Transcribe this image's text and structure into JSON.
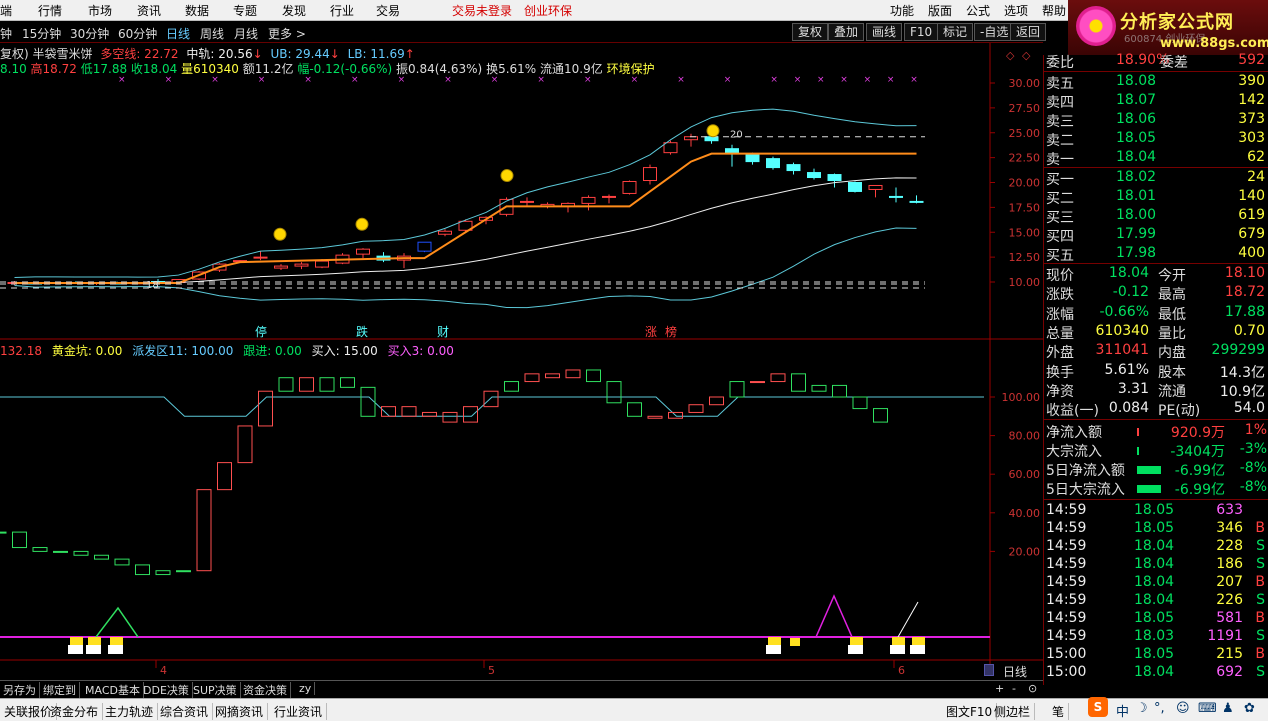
{
  "menu": {
    "items": [
      "端",
      "行情",
      "市场",
      "资讯",
      "数据",
      "专题",
      "发现",
      "行业",
      "交易"
    ],
    "login": "交易未登录",
    "promo": "创业环保",
    "right": [
      "功能",
      "版面",
      "公式",
      "选项",
      "帮助"
    ]
  },
  "periods": [
    "钟",
    "15分钟",
    "30分钟",
    "60分钟",
    "日线",
    "周线",
    "月线",
    "更多 >"
  ],
  "active_period": "日线",
  "toolbar": [
    "复权",
    "叠加",
    "画线",
    "F10",
    "标记",
    "-自选",
    "返回"
  ],
  "logo": {
    "title": "分析家公式网",
    "url": "www.88gs.com",
    "faint": "600874 创业环保"
  },
  "indicator_line": {
    "prefix": "复权) 半袋雪米饼",
    "duokong_label": "多空线: 22.72",
    "mid_label": "中轨: 20.56",
    "ub_label": "UB: 29.44",
    "lb_label": "LB: 11.69"
  },
  "ohlc_line": {
    "open": "8.10",
    "high": "高18.72",
    "low": "低17.88",
    "close": "收18.04",
    "volume": "量610340",
    "amount": "额11.2亿",
    "change": "幅-0.12(-0.66%)",
    "amplitude": "振0.84(4.63%)",
    "turnover": "换5.61%",
    "float": "流通10.9亿",
    "tag": "环境保护"
  },
  "main_axis": [
    "30.00",
    "27.50",
    "25.00",
    "22.50",
    "20.00",
    "17.50",
    "15.00",
    "12.50",
    "10.00"
  ],
  "main_annotations": [
    "停",
    "跌",
    "财",
    "涨",
    "榜"
  ],
  "price_label_left": "18",
  "price_label_top": "20",
  "sub_line": {
    "prefix": "132.18",
    "huangjin": "黄金坑: 0.00",
    "paifa": "派发区11: 100.00",
    "genjin": "跟进: 0.00",
    "mairu": "买入: 15.00",
    "mairu3": "买入3: 0.00"
  },
  "sub_axis": [
    "100.00",
    "80.00",
    "60.00",
    "40.00",
    "20.00"
  ],
  "date_labels": [
    "4",
    "5",
    "6"
  ],
  "period_corner": "日线",
  "bottom_tabs": [
    "另存为",
    "绑定到",
    "MACD基本",
    "DDE决策",
    "SUP决策",
    "资金决策",
    "zy"
  ],
  "bottom_tabs2": [
    "关联报价",
    "资金分布",
    "主力轨迹",
    "综合资讯",
    "网摘资讯",
    "行业资讯"
  ],
  "bottom_right": [
    "图文F10",
    "侧边栏"
  ],
  "tray_label": "笔",
  "ime": {
    "s": "S",
    "zh": "中"
  },
  "orderbook": {
    "header": {
      "label": "委比",
      "value": "18.90%",
      "label2": "委差",
      "value2": "592"
    },
    "asks": [
      {
        "label": "卖五",
        "price": "18.08",
        "vol": "390"
      },
      {
        "label": "卖四",
        "price": "18.07",
        "vol": "142"
      },
      {
        "label": "卖三",
        "price": "18.06",
        "vol": "373"
      },
      {
        "label": "卖二",
        "price": "18.05",
        "vol": "303"
      },
      {
        "label": "卖一",
        "price": "18.04",
        "vol": "62"
      }
    ],
    "bids": [
      {
        "label": "买一",
        "price": "18.02",
        "vol": "24"
      },
      {
        "label": "买二",
        "price": "18.01",
        "vol": "140"
      },
      {
        "label": "买三",
        "price": "18.00",
        "vol": "619"
      },
      {
        "label": "买四",
        "price": "17.99",
        "vol": "679"
      },
      {
        "label": "买五",
        "price": "17.98",
        "vol": "400"
      }
    ]
  },
  "quote": [
    {
      "l1": "现价",
      "v1": "18.04",
      "c1": "green",
      "l2": "今开",
      "v2": "18.10",
      "c2": "red"
    },
    {
      "l1": "涨跌",
      "v1": "-0.12",
      "c1": "green",
      "l2": "最高",
      "v2": "18.72",
      "c2": "red"
    },
    {
      "l1": "涨幅",
      "v1": "-0.66%",
      "c1": "green",
      "l2": "最低",
      "v2": "17.88",
      "c2": "green"
    },
    {
      "l1": "总量",
      "v1": "610340",
      "c1": "yellow",
      "l2": "量比",
      "v2": "0.70",
      "c2": "yellow"
    },
    {
      "l1": "外盘",
      "v1": "311041",
      "c1": "red",
      "l2": "内盘",
      "v2": "299299",
      "c2": "green"
    },
    {
      "l1": "换手",
      "v1": "5.61%",
      "c1": "white",
      "l2": "股本",
      "v2": "14.3亿",
      "c2": "white"
    },
    {
      "l1": "净资",
      "v1": "3.31",
      "c1": "white",
      "l2": "流通",
      "v2": "10.9亿",
      "c2": "white"
    },
    {
      "l1": "收益(一)",
      "v1": "0.084",
      "c1": "white",
      "l2": "PE(动)",
      "v2": "54.0",
      "c2": "white"
    }
  ],
  "flows": [
    {
      "label": "净流入额",
      "value": "920.9万",
      "pct": "1%",
      "color": "red"
    },
    {
      "label": "大宗流入",
      "value": "-3404万",
      "pct": "-3%",
      "color": "green"
    },
    {
      "label": "5日净流入额",
      "value": "-6.99亿",
      "pct": "-8%",
      "color": "green"
    },
    {
      "label": "5日大宗流入",
      "value": "-6.99亿",
      "pct": "-8%",
      "color": "green"
    }
  ],
  "ticks": [
    {
      "time": "14:59",
      "price": "18.05",
      "vol": "633",
      "side": "",
      "pc": "green",
      "vc": "mag"
    },
    {
      "time": "14:59",
      "price": "18.05",
      "vol": "346",
      "side": "B",
      "pc": "green",
      "vc": "yellow"
    },
    {
      "time": "14:59",
      "price": "18.04",
      "vol": "228",
      "side": "S",
      "pc": "green",
      "vc": "yellow"
    },
    {
      "time": "14:59",
      "price": "18.04",
      "vol": "186",
      "side": "S",
      "pc": "green",
      "vc": "yellow"
    },
    {
      "time": "14:59",
      "price": "18.04",
      "vol": "207",
      "side": "B",
      "pc": "green",
      "vc": "yellow"
    },
    {
      "time": "14:59",
      "price": "18.04",
      "vol": "226",
      "side": "S",
      "pc": "green",
      "vc": "yellow"
    },
    {
      "time": "14:59",
      "price": "18.05",
      "vol": "581",
      "side": "B",
      "pc": "green",
      "vc": "mag"
    },
    {
      "time": "14:59",
      "price": "18.03",
      "vol": "1191",
      "side": "S",
      "pc": "green",
      "vc": "mag"
    },
    {
      "time": "15:00",
      "price": "18.05",
      "vol": "215",
      "side": "B",
      "pc": "green",
      "vc": "yellow"
    },
    {
      "time": "15:00",
      "price": "18.04",
      "vol": "692",
      "side": "S",
      "pc": "green",
      "vc": "mag"
    }
  ],
  "candles": [
    [
      9.85,
      10.1,
      9.7,
      9.95
    ],
    [
      9.9,
      10.0,
      9.75,
      9.85
    ],
    [
      9.9,
      10.05,
      9.75,
      9.95
    ],
    [
      9.95,
      10.1,
      9.8,
      9.9
    ],
    [
      9.85,
      10.0,
      9.7,
      9.95
    ],
    [
      9.9,
      10.05,
      9.8,
      9.88
    ],
    [
      9.85,
      10.0,
      9.8,
      9.92
    ],
    [
      10.05,
      10.3,
      9.9,
      9.95
    ],
    [
      9.95,
      10.3,
      9.9,
      10.25
    ],
    [
      10.3,
      11.1,
      10.2,
      11.0
    ],
    [
      11.2,
      11.9,
      11.0,
      11.8
    ],
    [
      12.1,
      12.2,
      12.0,
      12.15
    ],
    [
      12.4,
      13.1,
      12.2,
      12.5
    ],
    [
      11.4,
      11.8,
      11.2,
      11.6
    ],
    [
      11.6,
      12.0,
      11.3,
      11.8
    ],
    [
      11.5,
      12.3,
      11.4,
      12.1
    ],
    [
      11.9,
      12.9,
      11.8,
      12.7
    ],
    [
      12.8,
      13.4,
      12.4,
      13.3
    ],
    [
      12.6,
      13.0,
      12.0,
      12.2
    ],
    [
      12.2,
      12.9,
      11.4,
      12.6
    ],
    [
      13.1,
      14.0,
      13.0,
      14.0
    ],
    [
      14.8,
      15.3,
      14.6,
      15.1
    ],
    [
      15.2,
      16.3,
      15.0,
      16.1
    ],
    [
      16.2,
      16.6,
      15.8,
      16.5
    ],
    [
      16.8,
      18.5,
      16.6,
      18.3
    ],
    [
      18.0,
      18.5,
      17.6,
      18.1
    ],
    [
      17.6,
      18.0,
      17.4,
      17.8
    ],
    [
      17.6,
      18.0,
      17.0,
      17.9
    ],
    [
      17.9,
      18.7,
      17.2,
      18.5
    ],
    [
      18.5,
      18.8,
      17.9,
      18.6
    ],
    [
      18.9,
      20.2,
      18.8,
      20.1
    ],
    [
      20.2,
      21.8,
      19.8,
      21.5
    ],
    [
      23.0,
      24.2,
      22.8,
      24.0
    ],
    [
      24.3,
      24.9,
      23.6,
      24.6
    ],
    [
      24.6,
      24.8,
      23.9,
      24.2
    ],
    [
      23.4,
      23.8,
      21.6,
      22.9
    ],
    [
      22.8,
      23.0,
      21.8,
      22.1
    ],
    [
      22.4,
      22.6,
      21.3,
      21.5
    ],
    [
      21.8,
      22.0,
      20.8,
      21.2
    ],
    [
      21.0,
      21.4,
      20.3,
      20.5
    ],
    [
      20.8,
      20.9,
      19.5,
      20.2
    ],
    [
      20.0,
      20.1,
      19.0,
      19.1
    ],
    [
      19.3,
      19.7,
      18.5,
      19.7
    ],
    [
      18.6,
      19.5,
      18.0,
      18.5
    ],
    [
      18.1,
      18.7,
      17.9,
      18.04
    ]
  ],
  "sub_values": [
    30,
    22,
    20,
    20,
    18,
    16,
    13,
    8,
    10,
    10,
    52,
    66,
    85,
    103,
    110,
    103,
    110,
    105,
    90,
    95,
    90,
    92,
    87,
    95,
    103,
    108,
    112,
    110,
    114,
    108,
    97,
    90,
    89,
    92,
    96,
    100,
    108,
    108,
    112,
    103,
    106,
    100,
    94,
    87,
    80,
    69,
    60,
    48,
    45,
    30,
    21,
    10
  ],
  "sub_colors": "ggggggggggrrrrgrgggrrrrrrgrrrgggrrrrgrrgggggggggg"
}
